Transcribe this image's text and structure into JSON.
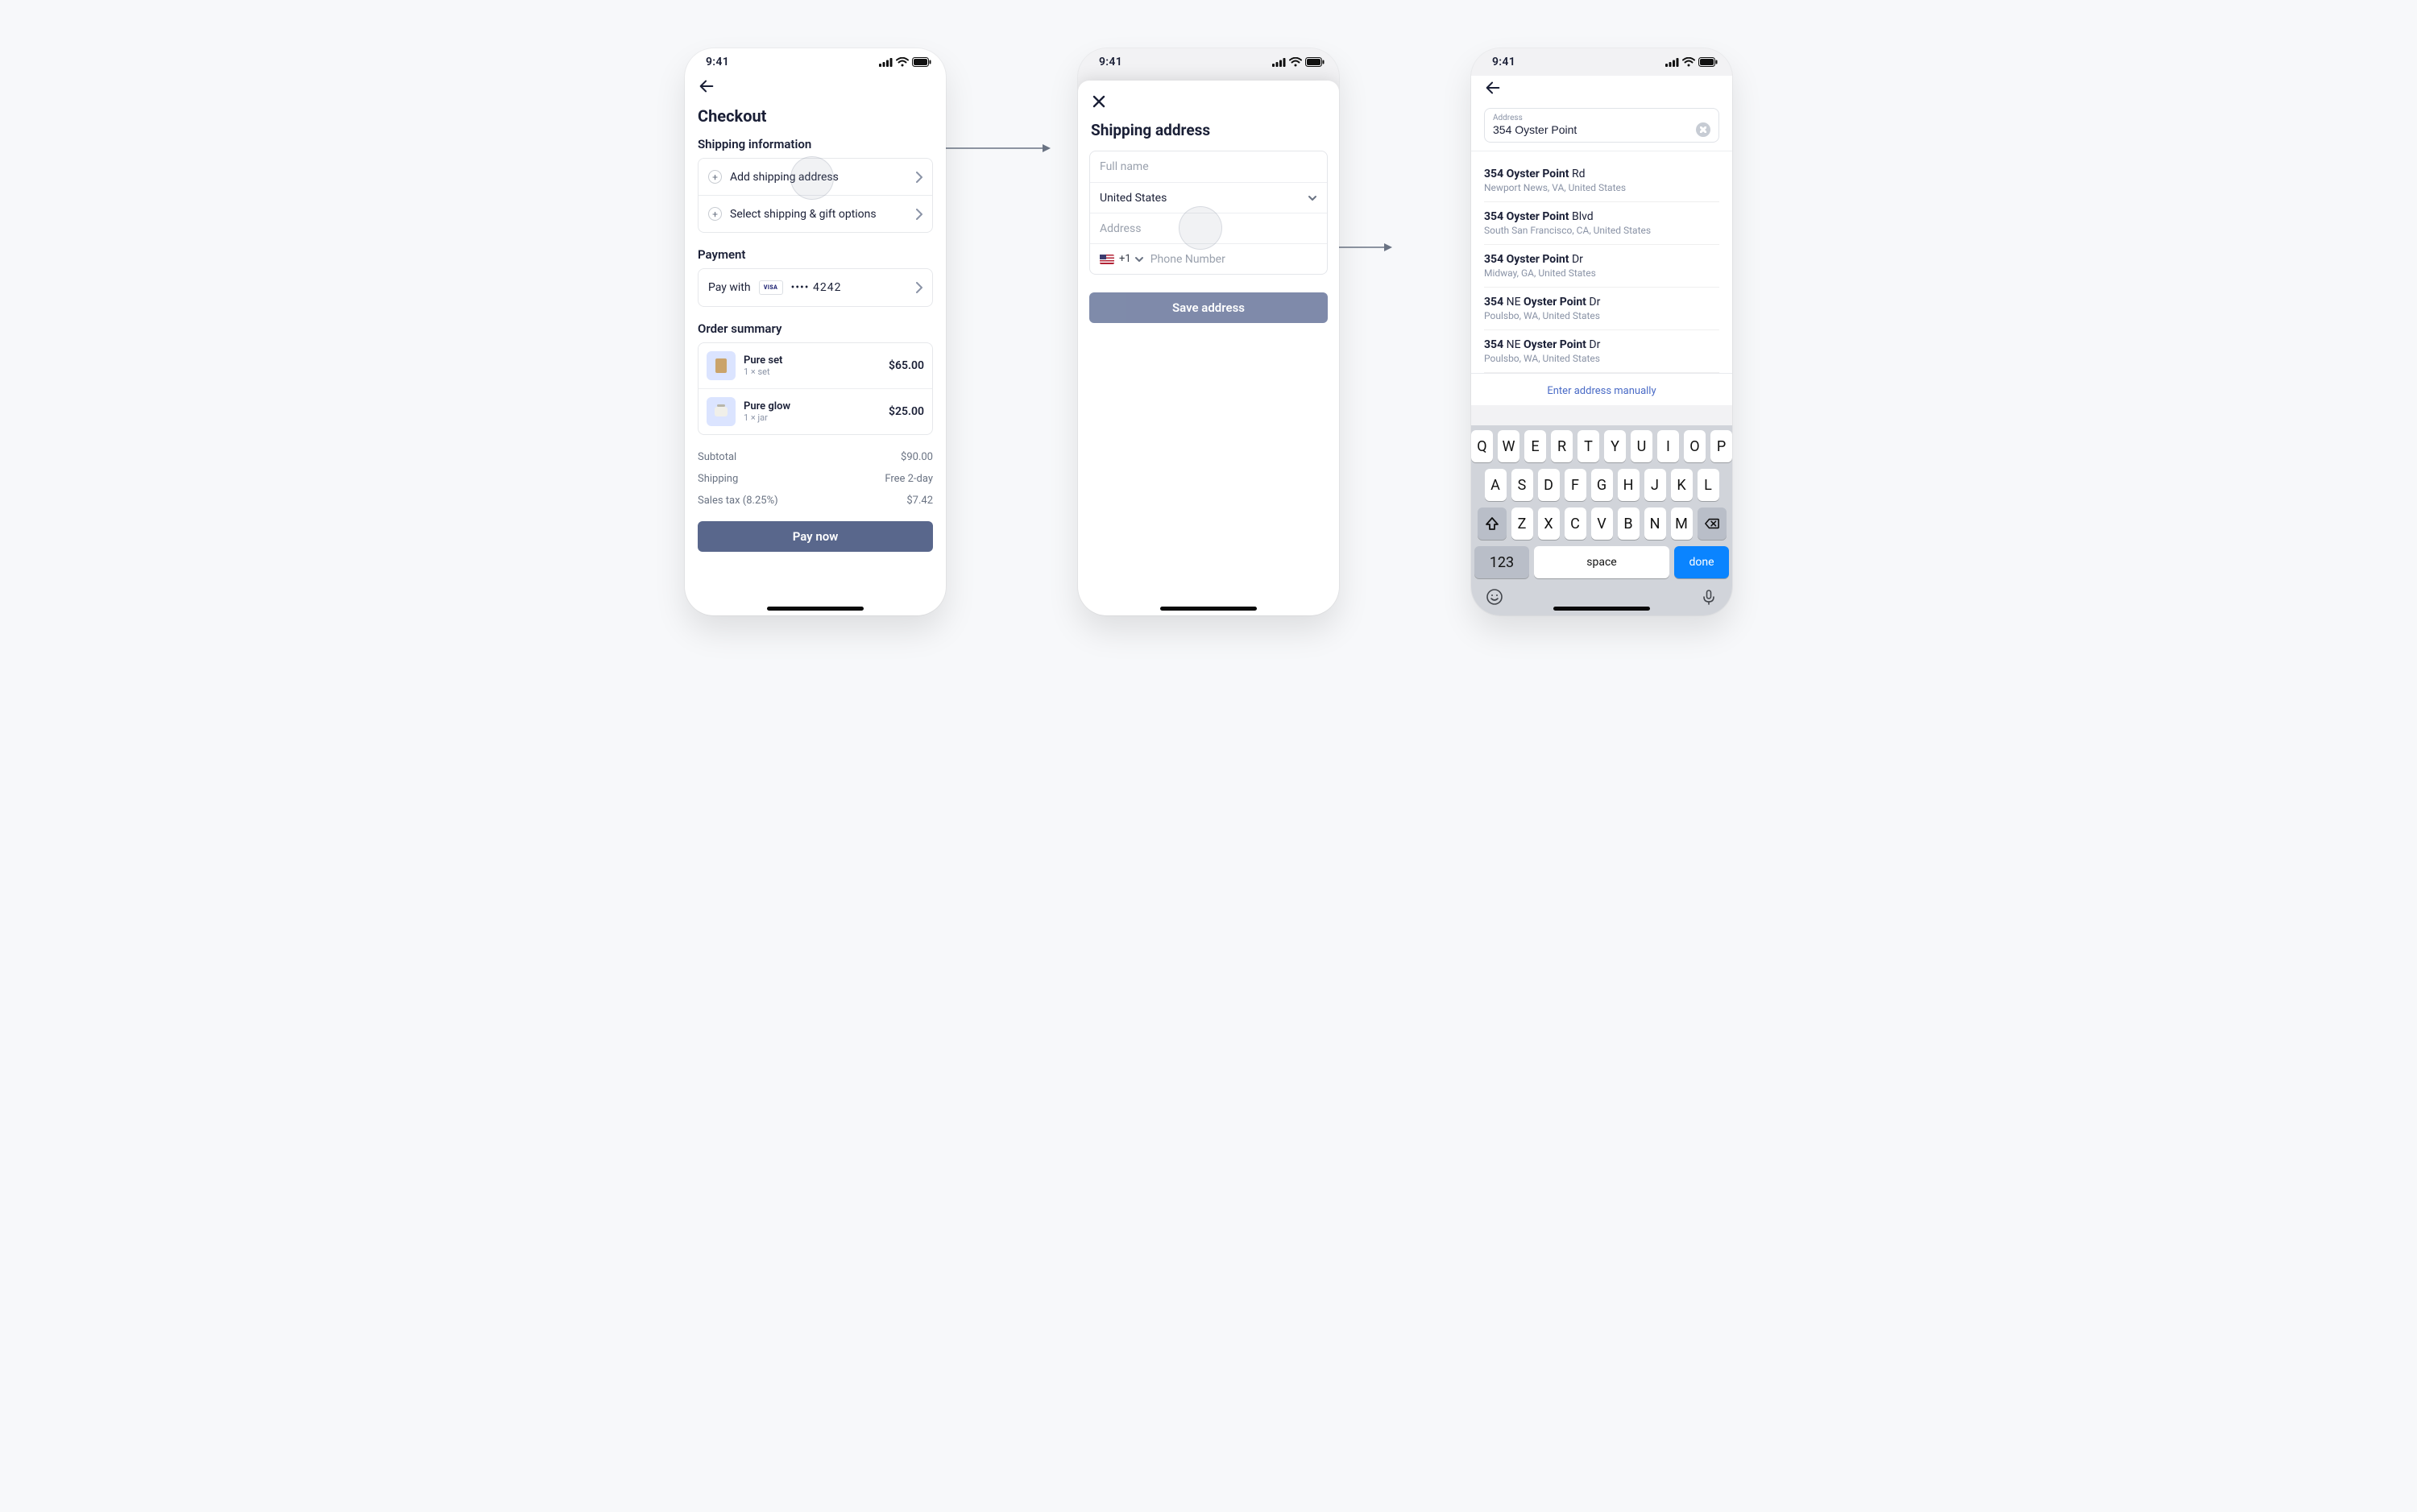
{
  "status_time": "9:41",
  "screen1": {
    "title": "Checkout",
    "shipping_heading": "Shipping information",
    "add_shipping": "Add shipping address",
    "select_shipping": "Select shipping & gift options",
    "payment_heading": "Payment",
    "pay_with": "Pay with",
    "card_brand": "VISA",
    "card_last4": "•••• 4242",
    "order_heading": "Order summary",
    "items": [
      {
        "name": "Pure set",
        "sub": "1 × set",
        "price": "$65.00"
      },
      {
        "name": "Pure glow",
        "sub": "1 × jar",
        "price": "$25.00"
      }
    ],
    "subtotal_label": "Subtotal",
    "subtotal": "$90.00",
    "shipping_label": "Shipping",
    "shipping": "Free 2-day",
    "tax_label": "Sales tax (8.25%)",
    "tax": "$7.42",
    "pay_now": "Pay now"
  },
  "screen2": {
    "title": "Shipping address",
    "full_name_ph": "Full name",
    "country": "United States",
    "address_ph": "Address",
    "dial_code": "+1",
    "phone_ph": "Phone Number",
    "save_btn": "Save address"
  },
  "screen3": {
    "label": "Address",
    "query": "354 Oyster Point",
    "manual": "Enter address manually",
    "suggestions": [
      {
        "b1": "354 Oyster Point",
        "r1": " Rd",
        "l2": "Newport News, VA, United States"
      },
      {
        "b1": "354 Oyster Point",
        "r1": " Blvd",
        "l2": "South San Francisco, CA, United States"
      },
      {
        "b1": "354 Oyster Point",
        "r1": " Dr",
        "l2": "Midway, GA, United States"
      },
      {
        "p1": "354 ",
        "b1": "NE ",
        "b2": "Oyster Point",
        "r1": " Dr",
        "l2": "Poulsbo, WA, United States"
      },
      {
        "p1": "354 ",
        "b1": "NE ",
        "b2": "Oyster Point",
        "r1": " Dr",
        "l2": "Poulsbo, WA, United States"
      }
    ],
    "kb": {
      "row1": [
        "Q",
        "W",
        "E",
        "R",
        "T",
        "Y",
        "U",
        "I",
        "O",
        "P"
      ],
      "row2": [
        "A",
        "S",
        "D",
        "F",
        "G",
        "H",
        "J",
        "K",
        "L"
      ],
      "row3": [
        "Z",
        "X",
        "C",
        "V",
        "B",
        "N",
        "M"
      ],
      "num": "123",
      "space": "space",
      "done": "done"
    }
  }
}
